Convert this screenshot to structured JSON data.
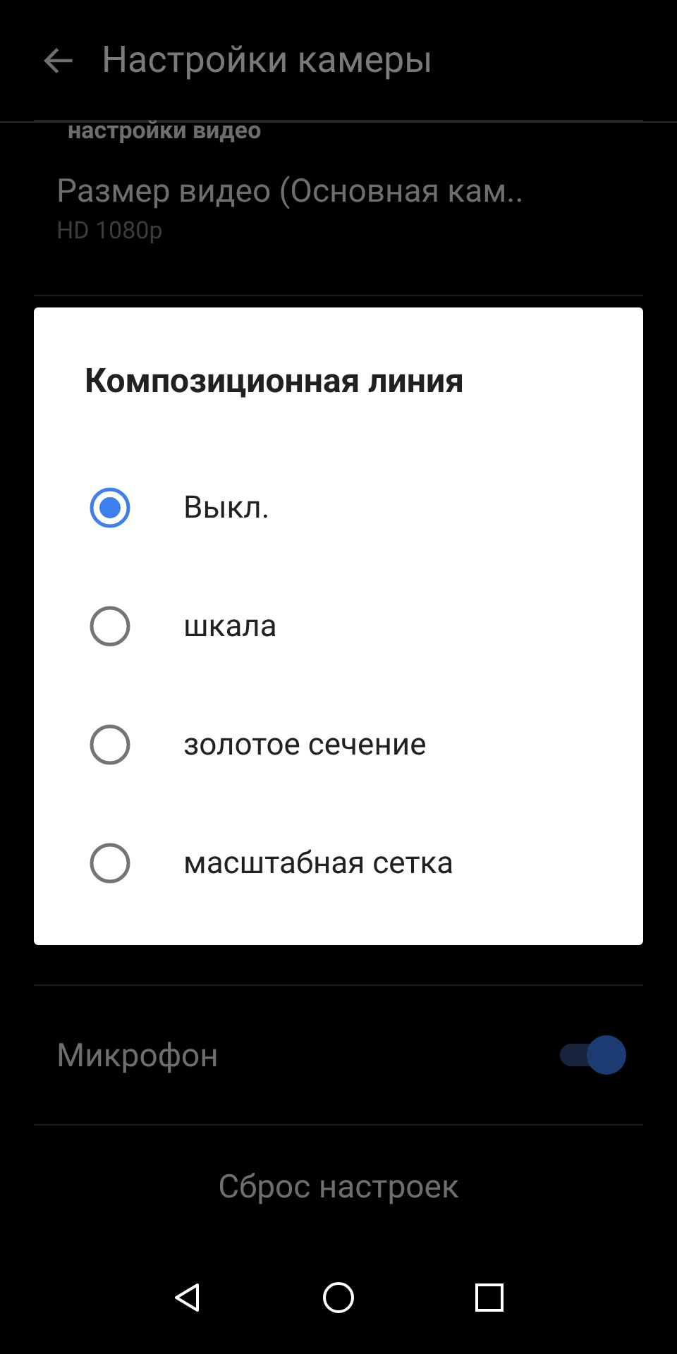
{
  "app_bar": {
    "title": "Настройки камеры"
  },
  "section": {
    "header": "настройки видео"
  },
  "video_size": {
    "title": "Размер видео (Основная кам..",
    "summary": "HD 1080p"
  },
  "microphone": {
    "label": "Микрофон",
    "on": true
  },
  "reset": {
    "label": "Сброс настроек"
  },
  "dialog": {
    "title": "Композиционная линия",
    "options": [
      {
        "label": "Выкл.",
        "selected": true
      },
      {
        "label": "шкала",
        "selected": false
      },
      {
        "label": "золотое сечение",
        "selected": false
      },
      {
        "label": "масштабная сетка",
        "selected": false
      }
    ]
  }
}
